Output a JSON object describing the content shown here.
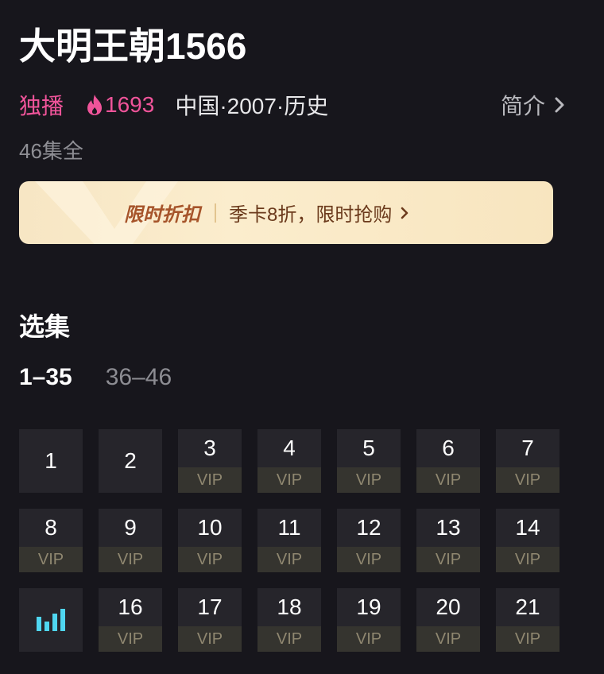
{
  "header": {
    "title": "大明王朝1566",
    "exclusive_label": "独播",
    "heat_value": "1693",
    "info": "中国·2007·历史",
    "intro_label": "简介",
    "episode_count": "46集全"
  },
  "promo": {
    "tag": "限时折扣",
    "text": "季卡8折，限时抢购"
  },
  "episodes": {
    "section_title": "选集",
    "ranges": [
      "1–35",
      "36–46"
    ],
    "active_range_index": 0,
    "vip_label": "VIP",
    "items": [
      {
        "num": "1",
        "vip": false
      },
      {
        "num": "2",
        "vip": false
      },
      {
        "num": "3",
        "vip": true
      },
      {
        "num": "4",
        "vip": true
      },
      {
        "num": "5",
        "vip": true
      },
      {
        "num": "6",
        "vip": true
      },
      {
        "num": "7",
        "vip": true
      },
      {
        "num": "8",
        "vip": true
      },
      {
        "num": "9",
        "vip": true
      },
      {
        "num": "10",
        "vip": true
      },
      {
        "num": "11",
        "vip": true
      },
      {
        "num": "12",
        "vip": true
      },
      {
        "num": "13",
        "vip": true
      },
      {
        "num": "14",
        "vip": true
      },
      {
        "num": "",
        "vip": false,
        "playing": true
      },
      {
        "num": "16",
        "vip": true
      },
      {
        "num": "17",
        "vip": true
      },
      {
        "num": "18",
        "vip": true
      },
      {
        "num": "19",
        "vip": true
      },
      {
        "num": "20",
        "vip": true
      },
      {
        "num": "21",
        "vip": true
      }
    ]
  },
  "colors": {
    "background": "#17161c",
    "accent_pink": "#f0549a",
    "playing_indicator": "#4fd6f0",
    "vip_text": "#8f8770"
  },
  "icons": {
    "heat": "flame-icon",
    "intro": "chevron-right-icon",
    "playing": "equalizer-bars-icon"
  }
}
